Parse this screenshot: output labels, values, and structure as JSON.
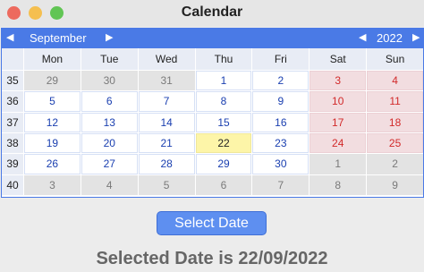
{
  "window": {
    "title": "Calendar"
  },
  "calendar": {
    "prev_month_icon": "arrow-left",
    "next_month_icon": "arrow-right",
    "month": "September",
    "year": "2022",
    "prev_year_icon": "arrow-left",
    "next_year_icon": "arrow-right",
    "weekday_headers": [
      "Mon",
      "Tue",
      "Wed",
      "Thu",
      "Fri",
      "Sat",
      "Sun"
    ],
    "weeks": [
      {
        "week": "35",
        "days": [
          {
            "d": "29",
            "type": "other"
          },
          {
            "d": "30",
            "type": "other"
          },
          {
            "d": "31",
            "type": "other"
          },
          {
            "d": "1",
            "type": "normal"
          },
          {
            "d": "2",
            "type": "normal"
          },
          {
            "d": "3",
            "type": "weekend"
          },
          {
            "d": "4",
            "type": "weekend"
          }
        ]
      },
      {
        "week": "36",
        "days": [
          {
            "d": "5",
            "type": "normal"
          },
          {
            "d": "6",
            "type": "normal"
          },
          {
            "d": "7",
            "type": "normal"
          },
          {
            "d": "8",
            "type": "normal"
          },
          {
            "d": "9",
            "type": "normal"
          },
          {
            "d": "10",
            "type": "weekend"
          },
          {
            "d": "11",
            "type": "weekend"
          }
        ]
      },
      {
        "week": "37",
        "days": [
          {
            "d": "12",
            "type": "normal"
          },
          {
            "d": "13",
            "type": "normal"
          },
          {
            "d": "14",
            "type": "normal"
          },
          {
            "d": "15",
            "type": "normal"
          },
          {
            "d": "16",
            "type": "normal"
          },
          {
            "d": "17",
            "type": "weekend"
          },
          {
            "d": "18",
            "type": "weekend"
          }
        ]
      },
      {
        "week": "38",
        "days": [
          {
            "d": "19",
            "type": "normal"
          },
          {
            "d": "20",
            "type": "normal"
          },
          {
            "d": "21",
            "type": "normal"
          },
          {
            "d": "22",
            "type": "selected"
          },
          {
            "d": "23",
            "type": "normal"
          },
          {
            "d": "24",
            "type": "weekend"
          },
          {
            "d": "25",
            "type": "weekend"
          }
        ]
      },
      {
        "week": "39",
        "days": [
          {
            "d": "26",
            "type": "normal"
          },
          {
            "d": "27",
            "type": "normal"
          },
          {
            "d": "28",
            "type": "normal"
          },
          {
            "d": "29",
            "type": "normal"
          },
          {
            "d": "30",
            "type": "normal"
          },
          {
            "d": "1",
            "type": "other"
          },
          {
            "d": "2",
            "type": "other"
          }
        ]
      },
      {
        "week": "40",
        "days": [
          {
            "d": "3",
            "type": "other"
          },
          {
            "d": "4",
            "type": "other"
          },
          {
            "d": "5",
            "type": "other"
          },
          {
            "d": "6",
            "type": "other"
          },
          {
            "d": "7",
            "type": "other"
          },
          {
            "d": "8",
            "type": "other"
          },
          {
            "d": "9",
            "type": "other"
          }
        ]
      }
    ]
  },
  "select_button": {
    "label": "Select Date"
  },
  "result_text": "Selected Date is 22/09/2022",
  "colors": {
    "accent": "#4a7ae6",
    "weekday_text": "#1a3fb0",
    "weekend_text": "#d22a2a",
    "weekend_bg": "#f2dde0",
    "selected_bg": "#fdf5a8",
    "other_month_bg": "#e3e3e3"
  }
}
